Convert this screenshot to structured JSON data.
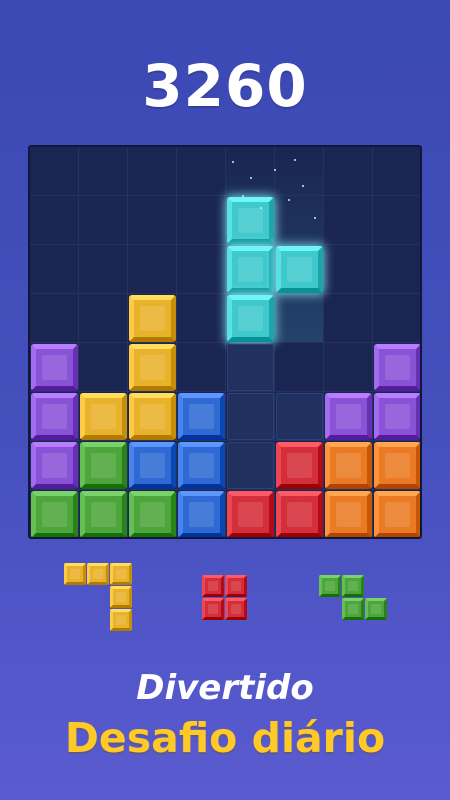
{
  "score": "3260",
  "headline": "Divertido",
  "subheadline": "Desafio diário",
  "colors": {
    "purple": "#8a52d6",
    "yellow": "#e9b22c",
    "blue": "#2f6ad4",
    "green": "#4da63b",
    "red": "#d42e3a",
    "orange": "#ea7a23",
    "cyan": "#3fc9cc"
  },
  "board": {
    "rows": 8,
    "cols": 8,
    "cells": [
      [
        null,
        null,
        null,
        null,
        "cyan",
        null,
        null,
        null
      ],
      [
        null,
        null,
        null,
        null,
        "cyan",
        "cyan",
        null,
        null
      ],
      [
        null,
        null,
        "yellow",
        null,
        "cyan",
        null,
        null,
        null
      ],
      [
        "purple",
        null,
        "yellow",
        null,
        "ghost",
        null,
        null,
        "purple"
      ],
      [
        "purple",
        "yellow",
        "yellow",
        "blue",
        "ghost",
        "ghost",
        "purple",
        "purple"
      ],
      [
        "purple",
        "green",
        "blue",
        "blue",
        "ghost",
        "red",
        "orange",
        "orange"
      ],
      [
        "green",
        "green",
        "green",
        "blue",
        "red",
        "red",
        "orange",
        "orange"
      ]
    ],
    "active_piece": {
      "shape": "T",
      "color": "cyan"
    }
  },
  "tray": [
    {
      "name": "yellow-l-piece",
      "color": "yellow",
      "cells": [
        [
          0,
          0
        ],
        [
          1,
          0
        ],
        [
          2,
          0
        ],
        [
          2,
          1
        ],
        [
          2,
          2
        ]
      ]
    },
    {
      "name": "red-square-piece",
      "color": "red",
      "cells": [
        [
          0,
          0
        ],
        [
          1,
          0
        ],
        [
          0,
          1
        ],
        [
          1,
          1
        ]
      ]
    },
    {
      "name": "green-z-piece",
      "color": "green",
      "cells": [
        [
          0,
          0
        ],
        [
          1,
          0
        ],
        [
          1,
          1
        ],
        [
          2,
          1
        ]
      ]
    }
  ]
}
